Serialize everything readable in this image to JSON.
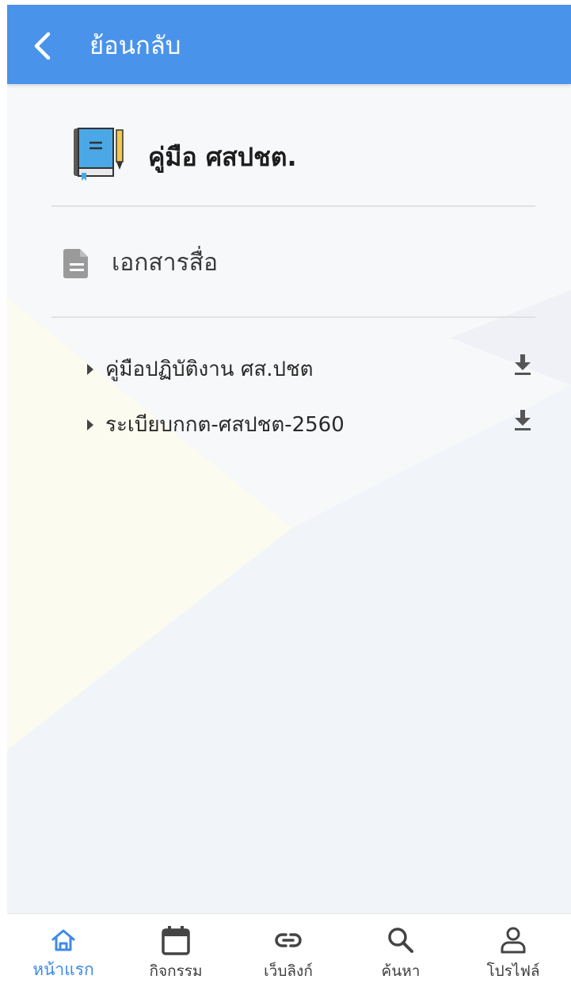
{
  "header": {
    "title": "ย้อนกลับ"
  },
  "manual": {
    "title": "คู่มือ ศสปชต."
  },
  "section": {
    "title": "เอกสารสื่อ"
  },
  "documents": [
    {
      "label": "คู่มือปฏิบัติงาน ศส.ปชต"
    },
    {
      "label": "ระเบียบกกต-ศสปชต-2560"
    }
  ],
  "bottom_nav": {
    "items": [
      {
        "label": "หน้าแรก",
        "icon": "home-icon",
        "active": true
      },
      {
        "label": "กิจกรรม",
        "icon": "calendar-icon",
        "active": false
      },
      {
        "label": "เว็บลิงก์",
        "icon": "link-icon",
        "active": false
      },
      {
        "label": "ค้นหา",
        "icon": "search-icon",
        "active": false
      },
      {
        "label": "โปรไฟล์",
        "icon": "profile-icon",
        "active": false
      }
    ]
  },
  "colors": {
    "header_bg": "#4a93ea",
    "active_nav": "#3d8be7",
    "book_blue": "#4aa8e6",
    "pencil_yellow": "#f2c94c"
  }
}
